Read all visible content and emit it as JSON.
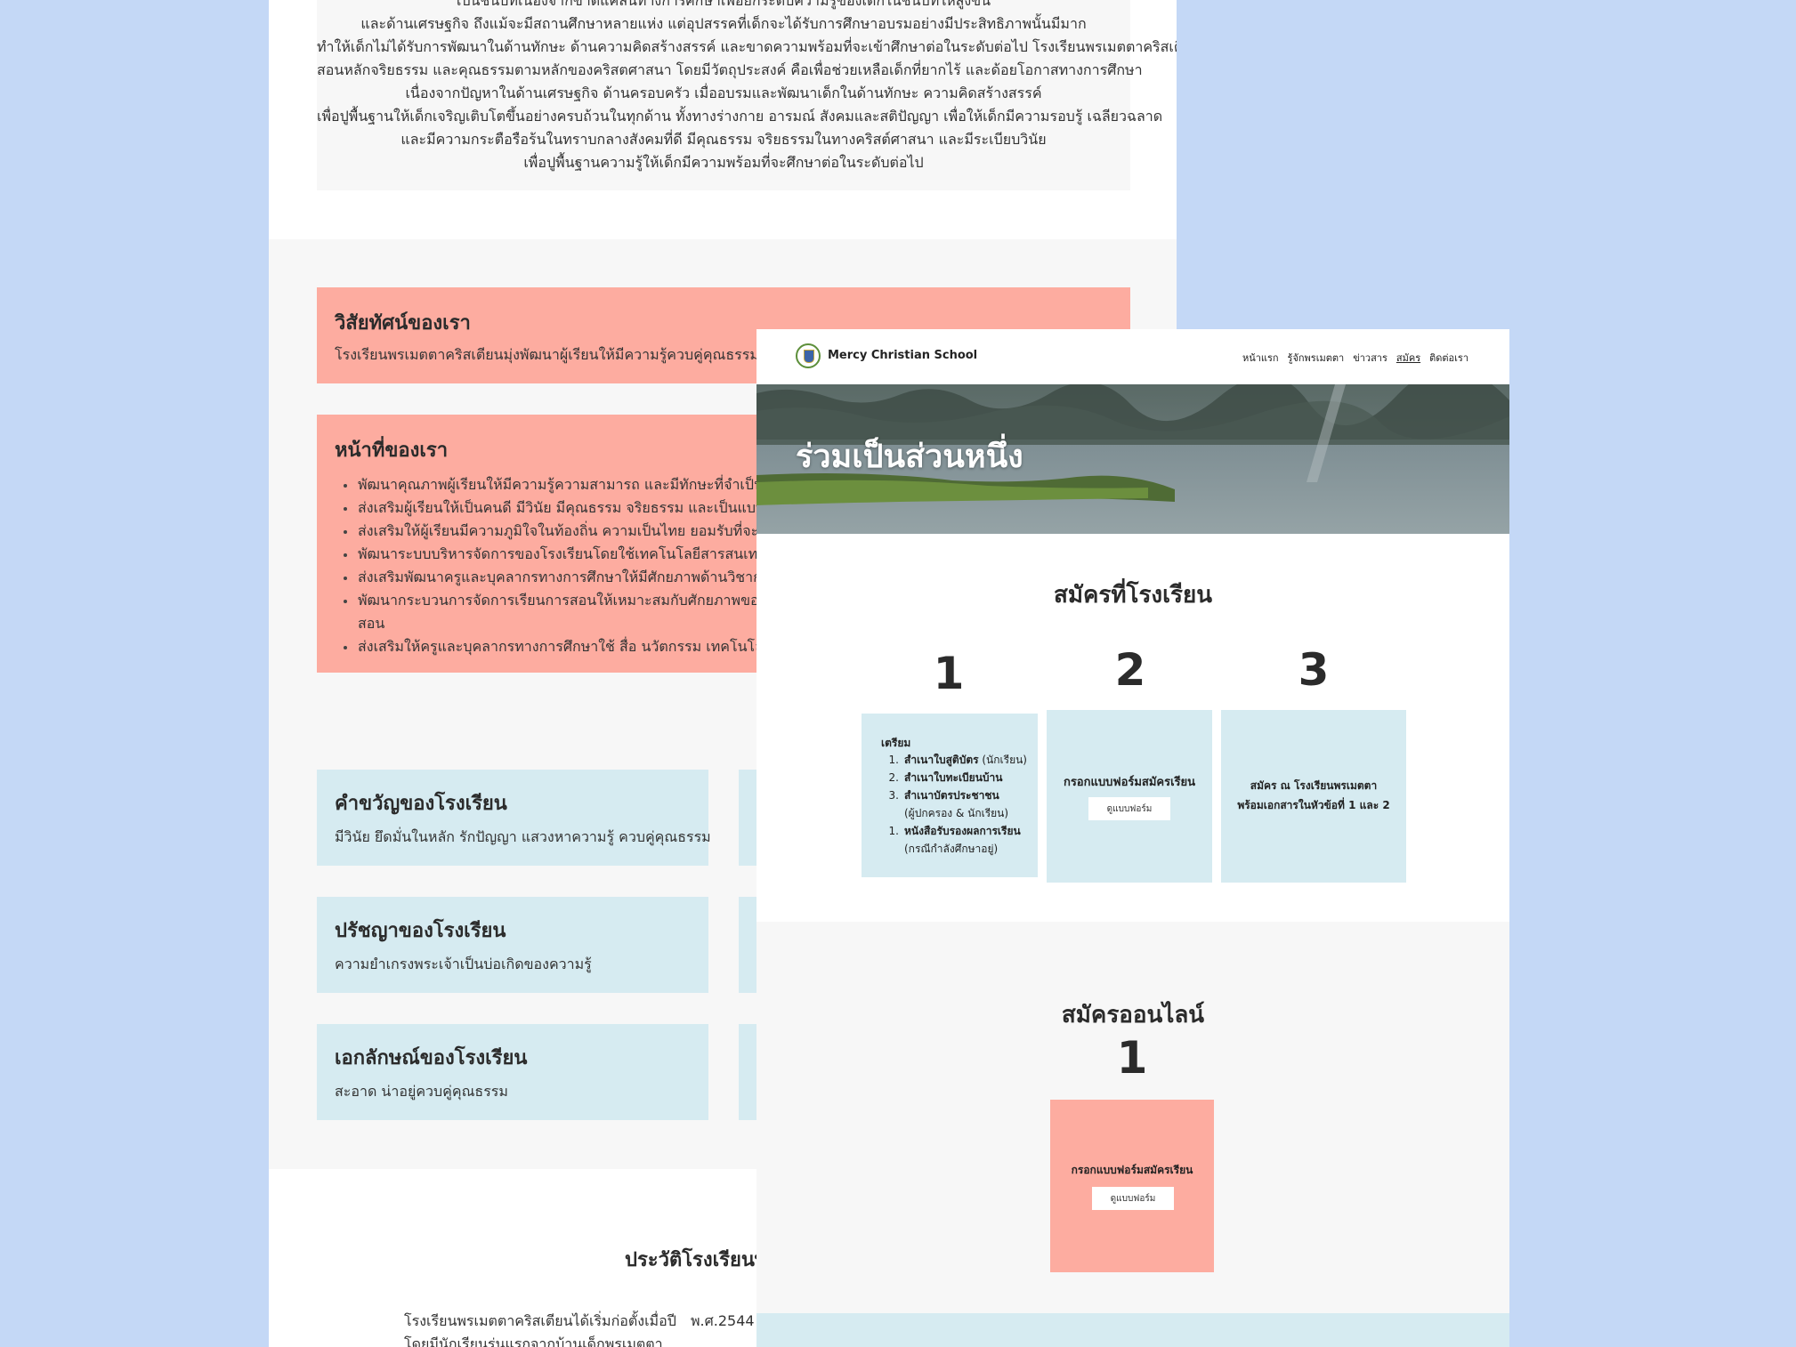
{
  "about_page": {
    "intro_lines": [
      "เป็นชนบทเนองจากขาดแคลนทางการศึกษาเพอยกระดบความรูของเด็กในชนบทใหสูงขึ้น",
      "และด้านเศรษฐกิจ ถึงแม้จะมีสถานศึกษาหลายแห่ง แต่อุปสรรคที่เด็กจะได้รับการศึกษาอบรมอย่างมีประสิทธิภาพนั้นมีมาก",
      "ทำให้เด็กไม่ได้รับการพัฒนาในด้านทักษะ ด้านความคิดสร้างสรรค์ และขาดความพร้อมที่จะเข้าศึกษาต่อในระดับต่อไป โรงเรียนพรเมตตาคริสเตียน",
      "สอนหลักจริยธรรม และคุณธรรมตามหลักของคริสตศาสนา โดยมีวัตถุประสงค์ คือเพื่อช่วยเหลือเด็กที่ยากไร้ และด้อยโอกาสทางการศึกษา",
      "เนื่องจากปัญหาในด้านเศรษฐกิจ ด้านครอบครัว เมื่ออบรมและพัฒนาเด็กในด้านทักษะ ความคิดสร้างสรรค์",
      "เพื่อปูพื้นฐานให้เด็กเจริญเติบโตขึ้นอย่างครบถ้วนในทุกด้าน ทั้งทางร่างกาย อารมณ์ สังคมและสติปัญญา เพื่อให้เด็กมีความรอบรู้ เฉลียวฉลาด",
      "และมีความกระตือรือร้นในทราบกลางสังคมที่ดี มีคุณธรรม จริยธรรมในทางคริสต์ศาสนา และมีระเบียบวินัย",
      "เพื่อปูพื้นฐานความรู้ให้เด็กมีความพร้อมที่จะศึกษาต่อในระดับต่อไป"
    ],
    "vision": {
      "title": "วิสัยทัศน์ของเรา",
      "text": "โรงเรียนพรเมตตาคริสเตียนมุ่งพัฒนาผู้เรียนให้มีความรู้ควบคู่คุณธรรม มีระเบียบ"
    },
    "mission": {
      "title": "หน้าที่ของเรา",
      "items": [
        "พัฒนาคุณภาพผู้เรียนให้มีความรู้ความสามารถ และมีทักษะที่จำเป็นตามหลัก",
        "ส่งเสริมผู้เรียนให้เป็นคนดี มีวินัย มีคุณธรรม จริยธรรม และเป็นแบบอย่างที่ดี",
        "ส่งเสริมให้ผู้เรียนมีความภูมิใจในท้องถิ่น ความเป็นไทย ยอมรับที่จะอยู่ร่วมกัน",
        "พัฒนาระบบบริหารจัดการของโรงเรียนโดยใช้เทคโนโลยีสารสนเทศที่มีประสิ",
        "ส่งเสริมพัฒนาครูและบุคลากรทางการศึกษาให้มีศักยภาพด้านวิชาการ มีจรร",
        "พัฒนากระบวนการจัดการเรียนการสอนให้เหมาะสมกับศักยภาพของผู้เรียนโ",
        "ส่งเสริมให้ครูและบุคลากรทางการศึกษาใช้ สื่อ นวัตกรรม เทคโนโลยี และการ"
      ],
      "wrap_line": "สอน"
    },
    "cards": [
      {
        "title": "คำขวัญของโรงเรียน",
        "text": "มีวินัย ยึดมั่นในหลัก รักปัญญา แสวงหาความรู้ ควบคู่คุณธรรม"
      },
      {
        "title": "ปรัชญาของโรงเรียน",
        "text": "ความยำเกรงพระเจ้าเป็นบ่อเกิดของความรู้"
      },
      {
        "title": "เอกลักษณ์ของโรงเรียน",
        "text": "สะอาด น่าอยู่ควบคู่คุณธรรม"
      }
    ],
    "history": {
      "title": "ประวัติโรงเรียนพร",
      "lines": [
        "โรงเรียนพรเมตตาคริสเตียนได้เริ่มก่อตั้งเมื่อปี",
        "โดยมีนักเรียนรุ่นแรกจากบ้านเด็กพรเมตตา"
      ],
      "year": "พ.ศ.2544"
    }
  },
  "join_page": {
    "brand": "Mercy Christian School",
    "nav": [
      {
        "label": "หน้าแรก",
        "active": false
      },
      {
        "label": "รู้จักพรเมตตา",
        "active": false
      },
      {
        "label": "ข่าวสาร",
        "active": false
      },
      {
        "label": "สมัคร",
        "active": true
      },
      {
        "label": "ติดต่อเรา",
        "active": false
      }
    ],
    "hero_title": "ร่วมเป็นส่วนหนึ่ง",
    "apply_title": "สมัครที่โรงเรียน",
    "steps": [
      {
        "number": "1",
        "heading": "เตรียม",
        "documents": [
          {
            "num": "1.",
            "bold": "สำเนาใบสูติบัตร",
            "note": " (นักเรียน)"
          },
          {
            "num": "2.",
            "bold": "สำเนาใบทะเบียนบ้าน",
            "note": ""
          },
          {
            "num": "3.",
            "bold": "สำเนาบัตรประชาชน",
            "note": ""
          },
          {
            "num": "",
            "bold": "",
            "note": "(ผู้ปกครอง & นักเรียน)"
          },
          {
            "num": "1.",
            "bold": "หนังสือรับรองผลการเรียน",
            "note": ""
          },
          {
            "num": "",
            "bold": "",
            "note": "(กรณีกำลังศึกษาอยู่)"
          }
        ]
      },
      {
        "number": "2",
        "text": "กรอกแบบฟอร์มสมัครเรียน",
        "button": "ดูแบบฟอร์ม"
      },
      {
        "number": "3",
        "text_lines": [
          "สมัคร ณ โรงเรียนพรเมตตา",
          "พร้อมเอกสารในหัวข้อที่ 1 และ 2"
        ]
      }
    ],
    "online_title": "สมัครออนไลน์",
    "online_step": {
      "number": "1",
      "text": "กรอกแบบฟอร์มสมัครเรียน",
      "button": "ดูแบบฟอร์ม"
    }
  },
  "colors": {
    "background": "#c4d8f6",
    "pink_card": "#fdaca0",
    "blue_card": "#d6ebf1",
    "gray_band": "#f7f7f7"
  }
}
